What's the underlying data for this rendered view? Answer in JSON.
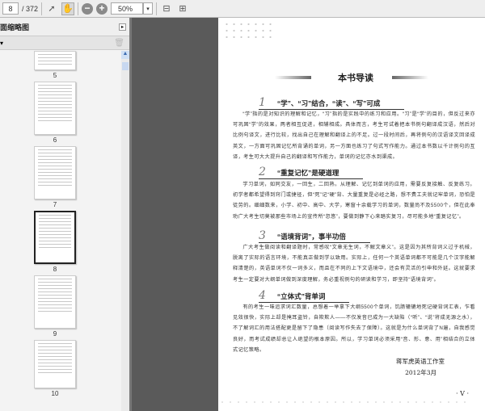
{
  "toolbar": {
    "page_current": "8",
    "page_total": "/ 372",
    "zoom": "50%"
  },
  "sidebar": {
    "title": "面缩略图",
    "menu": "▾",
    "thumbnails": [
      {
        "label": "5"
      },
      {
        "label": "6"
      },
      {
        "label": "7"
      },
      {
        "label": "8",
        "selected": true
      },
      {
        "label": "9"
      },
      {
        "label": "10"
      }
    ]
  },
  "page": {
    "title": "本书导读",
    "sections": [
      {
        "num": "1",
        "heading": "“学”、“习”结合，“读”、“写”可成",
        "text": "“学”指的是对知识的理解和记忆，“习”指的是实践中的练习和应用。“习”是“学”的目的，但反过来亦可巩固“学”的效果，两者相互促进，相辅相成。具体而言，考生可试着把本书例句翻译成汉语，然后对比例句译文，进行比较，找出自己在理解和翻译上的不足。过一段时间后，再将例句的汉语译文回译成英文，一方面可巩固记忆所背诵的单词，另一方面也练习了句式写作能力。通过本书数以千计例句的互译，考生可大大提升自己的翻译和写作能力，单词的记忆亦水到渠成。"
      },
      {
        "num": "2",
        "heading": "“重复记忆”是硬道理",
        "text": "学习单词，如同交友，一回生，二回熟。从理解、记忆到单词的应用，需要反复接触、反复练习。初学者都希望得到窍门或捷径，但“死”记“硬”背、大量重复是必经之路，想不费工夫就记牢单词，恐怕是徒劳的。细细数来，小学、初中、高中、大学，寒窗十余载学习的单词，数量尚不及5500个，但在此奉劝广大考生切莫被那些市场上的宣传所“忽悠”，要做到静下心来踏实复习，尽可能多地“重复记忆”。"
      },
      {
        "num": "3",
        "heading": "“语境背词”，事半功倍",
        "text": "广大考生做阅读和翻译题时，常感叹“文章无生词，不解文章义”。这是因为其所背词义过于机械，脱离了实际的语言环境，不能真正做到学以致用。实际上，任何一个英语单词都不可能是几个汉字能解释清楚的，英语单词不仅一词多义，而且在不同的上下文语境中，还会有灵活的引申和外延。这就要求考生一定要对大纲单词做到深度理解，务必重视例句的研读和学习，即坚持“语境背词”。"
      },
      {
        "num": "4",
        "heading": "“立体式”背单词",
        "text": "有的考生一味追求词汇数量，总想着一举拿下大纲5500个单词，饥肠辘辘地死记硬背词汇表，乍看见效很快，实际上却是掩耳盗铃，自欺欺人——不仅发音已成为一大缺陷（“听”、“说”将成无源之水），不了解词汇的用法搭配更是留下了隐患（阅读写作失去了保障）。这就是为什么单词背了N遍，自我感觉良好，而考试成绩却总让人绝望的根本原因。所以，学习单词必须采用“音、形、意、用”相结合的立体式记忆策略。"
      }
    ],
    "signature": "蒋军虎英语工作室",
    "date": "2012年3月",
    "page_number": "· V ·"
  }
}
